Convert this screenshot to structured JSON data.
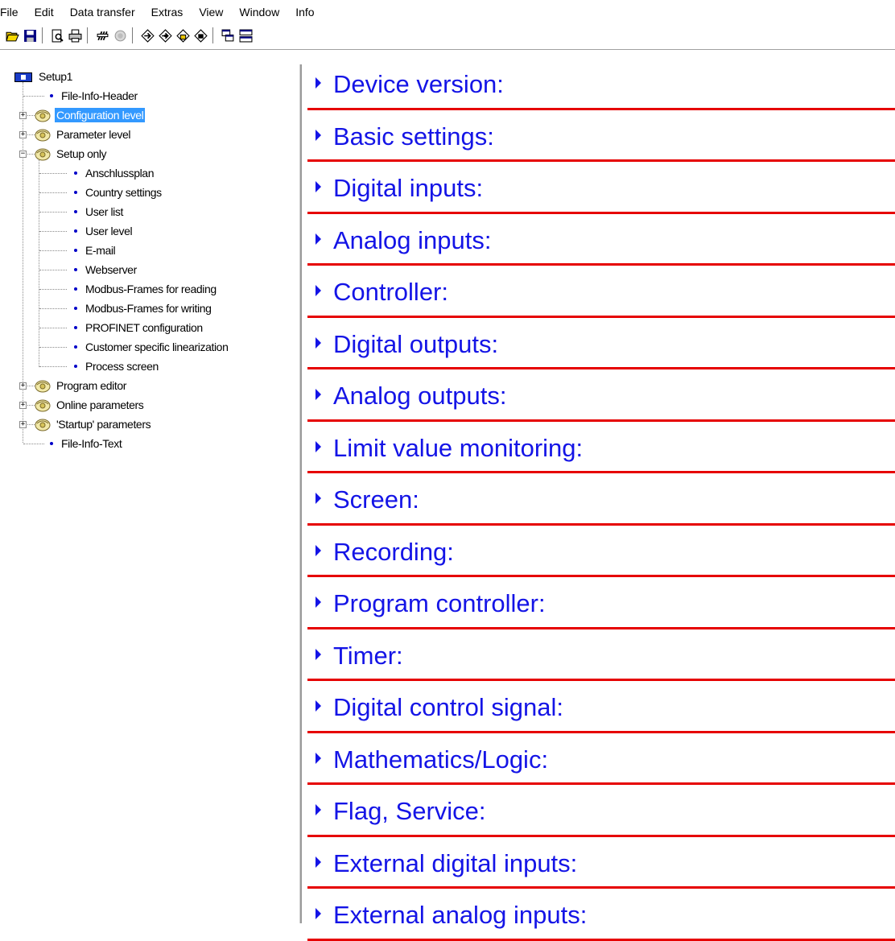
{
  "menu": [
    "File",
    "Edit",
    "Data transfer",
    "Extras",
    "View",
    "Window",
    "Info"
  ],
  "toolbar": {
    "icons": [
      "open-icon",
      "save-icon",
      "print-preview-icon",
      "print-icon",
      "link-icon",
      "disabled-icon",
      "transfer-to-device-icon",
      "transfer-from-device-icon",
      "upload-icon",
      "download-icon",
      "cascade-windows-icon",
      "tile-windows-icon"
    ]
  },
  "tree": {
    "root": "Setup1",
    "items": [
      {
        "label": "File-Info-Header",
        "kind": "leaf"
      },
      {
        "label": "Configuration level",
        "kind": "folder",
        "selected": true
      },
      {
        "label": "Parameter level",
        "kind": "folder"
      },
      {
        "label": "Setup only",
        "kind": "folder",
        "expanded": true
      },
      {
        "label": "Anschlussplan",
        "kind": "child"
      },
      {
        "label": "Country settings",
        "kind": "child"
      },
      {
        "label": "User list",
        "kind": "child"
      },
      {
        "label": "User level",
        "kind": "child"
      },
      {
        "label": "E-mail",
        "kind": "child"
      },
      {
        "label": "Webserver",
        "kind": "child"
      },
      {
        "label": "Modbus-Frames for reading",
        "kind": "child"
      },
      {
        "label": "Modbus-Frames for writing",
        "kind": "child"
      },
      {
        "label": "PROFINET configuration",
        "kind": "child"
      },
      {
        "label": "Customer specific linearization",
        "kind": "child"
      },
      {
        "label": "Process screen",
        "kind": "child"
      },
      {
        "label": "Program editor",
        "kind": "folder"
      },
      {
        "label": "Online parameters",
        "kind": "folder"
      },
      {
        "label": "'Startup' parameters",
        "kind": "folder"
      },
      {
        "label": "File-Info-Text",
        "kind": "leaf"
      }
    ]
  },
  "sections": [
    "Device version:",
    "Basic settings:",
    "Digital inputs:",
    "Analog inputs:",
    "Controller:",
    "Digital outputs:",
    "Analog outputs:",
    "Limit value monitoring:",
    "Screen:",
    "Recording:",
    "Program controller:",
    "Timer:",
    "Digital control signal:",
    "Mathematics/Logic:",
    "Flag, Service:",
    "External digital inputs:",
    "External analog inputs:"
  ],
  "colors": {
    "section_text": "#1414e6",
    "section_rule": "#e60000",
    "selection": "#3399ff"
  }
}
